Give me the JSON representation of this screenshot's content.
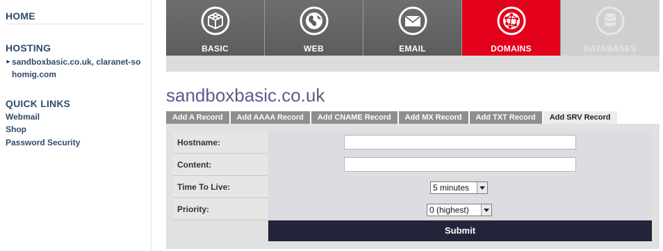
{
  "sidebar": {
    "home": "HOME",
    "hosting": "HOSTING",
    "site_link": "sandboxbasic.co.uk, claranet-sohomig.com",
    "quick_links_title": "QUICK LINKS",
    "quick_links": [
      "Webmail",
      "Shop",
      "Password Security"
    ]
  },
  "services": [
    {
      "label": "BASIC",
      "icon": "cube-icon",
      "state": "normal"
    },
    {
      "label": "WEB",
      "icon": "globe-icon",
      "state": "normal"
    },
    {
      "label": "EMAIL",
      "icon": "envelope-icon",
      "state": "normal"
    },
    {
      "label": "DOMAINS",
      "icon": "network-globe-icon",
      "state": "active"
    },
    {
      "label": "DATABASES",
      "icon": "database-icon",
      "state": "disabled"
    }
  ],
  "domain_title": "sandboxbasic.co.uk",
  "record_tabs": [
    "Add A Record",
    "Add AAAA Record",
    "Add CNAME Record",
    "Add MX Record",
    "Add TXT Record",
    "Add SRV Record"
  ],
  "active_record_tab": "Add SRV Record",
  "form": {
    "hostname_label": "Hostname:",
    "hostname_value": "",
    "content_label": "Content:",
    "content_value": "",
    "ttl_label": "Time To Live:",
    "ttl_value": "5 minutes",
    "priority_label": "Priority:",
    "priority_value": "0 (highest)",
    "submit_label": "Submit"
  },
  "colors": {
    "accent_red": "#e3001b",
    "tab_grey": "#5c5c5c",
    "link_blue": "#2f4a6b",
    "title_purple": "#5f5a8c",
    "submit_dark": "#24243a"
  }
}
